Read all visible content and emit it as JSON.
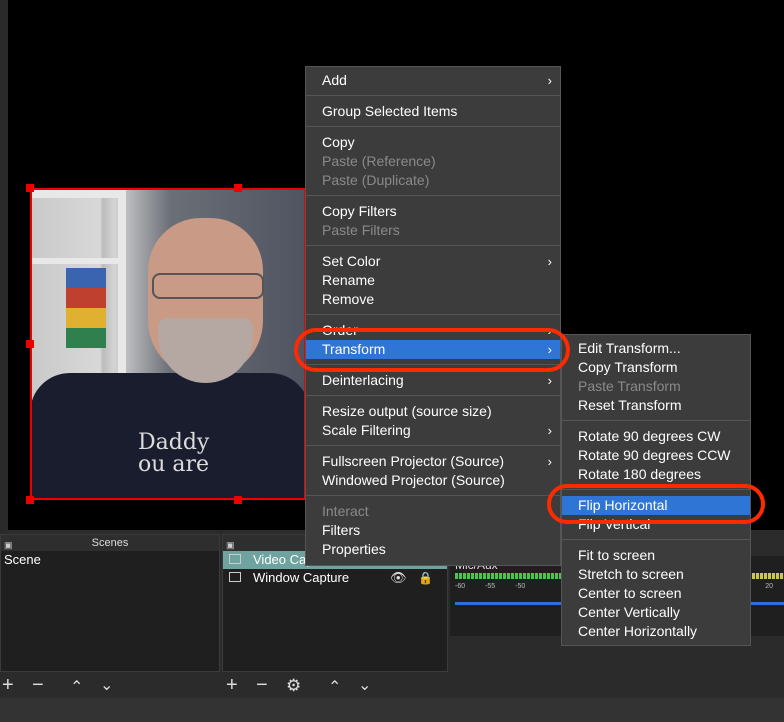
{
  "context_menu": {
    "items": [
      {
        "label": "Add",
        "disabled": false,
        "submenu": true
      },
      {
        "sep": true
      },
      {
        "label": "Group Selected Items",
        "disabled": false
      },
      {
        "sep": true
      },
      {
        "label": "Copy",
        "disabled": false
      },
      {
        "label": "Paste (Reference)",
        "disabled": true
      },
      {
        "label": "Paste (Duplicate)",
        "disabled": true
      },
      {
        "sep": true
      },
      {
        "label": "Copy Filters",
        "disabled": false
      },
      {
        "label": "Paste Filters",
        "disabled": true
      },
      {
        "sep": true
      },
      {
        "label": "Set Color",
        "disabled": false,
        "submenu": true
      },
      {
        "label": "Rename",
        "disabled": false
      },
      {
        "label": "Remove",
        "disabled": false
      },
      {
        "sep": true
      },
      {
        "label": "Order",
        "disabled": false,
        "submenu": true
      },
      {
        "label": "Transform",
        "disabled": false,
        "submenu": true,
        "highlighted": true
      },
      {
        "sep": true
      },
      {
        "label": "Deinterlacing",
        "disabled": false,
        "submenu": true
      },
      {
        "sep": true
      },
      {
        "label": "Resize output (source size)",
        "disabled": false
      },
      {
        "label": "Scale Filtering",
        "disabled": false,
        "submenu": true
      },
      {
        "sep": true
      },
      {
        "label": "Fullscreen Projector (Source)",
        "disabled": false,
        "submenu": true
      },
      {
        "label": "Windowed Projector (Source)",
        "disabled": false
      },
      {
        "sep": true
      },
      {
        "label": "Interact",
        "disabled": true
      },
      {
        "label": "Filters",
        "disabled": false
      },
      {
        "label": "Properties",
        "disabled": false
      }
    ]
  },
  "transform_menu": {
    "items": [
      {
        "label": "Edit Transform...",
        "disabled": false
      },
      {
        "label": "Copy Transform",
        "disabled": false
      },
      {
        "label": "Paste Transform",
        "disabled": true
      },
      {
        "label": "Reset Transform",
        "disabled": false
      },
      {
        "sep": true
      },
      {
        "label": "Rotate 90 degrees CW",
        "disabled": false
      },
      {
        "label": "Rotate 90 degrees CCW",
        "disabled": false
      },
      {
        "label": "Rotate 180 degrees",
        "disabled": false
      },
      {
        "sep": true
      },
      {
        "label": "Flip Horizontal",
        "disabled": false,
        "highlighted": true
      },
      {
        "label": "Flip Vertical",
        "disabled": false
      },
      {
        "sep": true
      },
      {
        "label": "Fit to screen",
        "disabled": false
      },
      {
        "label": "Stretch to screen",
        "disabled": false
      },
      {
        "label": "Center to screen",
        "disabled": false
      },
      {
        "label": "Center Vertically",
        "disabled": false
      },
      {
        "label": "Center Horizontally",
        "disabled": false
      }
    ]
  },
  "scenes": {
    "title": "Scenes",
    "items": [
      "Scene"
    ]
  },
  "sources": {
    "items": [
      {
        "label": "Video Capture Devic",
        "selected": true,
        "icon": "camera-icon"
      },
      {
        "label": "Window Capture",
        "selected": false,
        "icon": "window-icon"
      }
    ]
  },
  "mixer": {
    "label": "Mic/Aux",
    "ticks": [
      "-60",
      "-55",
      "-50",
      "20"
    ]
  },
  "webcam_text": [
    "Daddy",
    "ou are"
  ],
  "colors": {
    "highlight": "#2f75d6",
    "annotation": "#ff2a00",
    "selection": "#e00000"
  }
}
